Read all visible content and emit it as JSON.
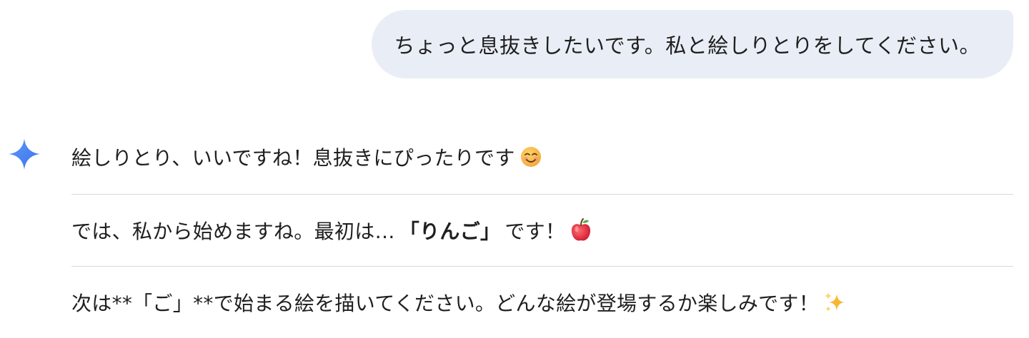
{
  "user_message": {
    "text": "ちょっと息抜きしたいです。私と絵しりとりをしてください。"
  },
  "model_response": {
    "icon": "gemini-sparkle-icon",
    "paragraphs": [
      {
        "text": "絵しりとり、いいですね！息抜きにぴったりです",
        "emoji": "smiling-face-icon"
      },
      {
        "text_before": "では、私から始めますね。最初は… ",
        "strong": "「りんご」",
        "text_after": " です！",
        "emoji": "apple-icon"
      },
      {
        "text": "次は**「ご」**で始まる絵を描いてください。どんな絵が登場するか楽しみです！",
        "emoji": "sparkles-icon"
      }
    ]
  },
  "colors": {
    "user_bubble_bg": "#e9eef6",
    "sparkle_blue": "#4285f4",
    "divider": "#d8d8d8",
    "text": "#1f1f1f"
  }
}
